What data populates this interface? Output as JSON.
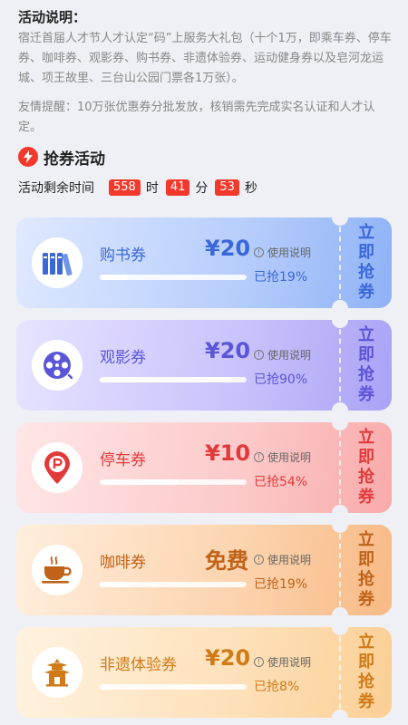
{
  "intro": {
    "title": "活动说明：",
    "body": "宿迁首届人才节人才认定“码”上服务大礼包（十个1万，即乘车券、停车券、咖啡券、观影券、购书券、非遗体验券、运动健身券以及皂河龙运城、项王故里、三台山公园门票各1万张）。",
    "tip": "友情提醒：10万张优惠券分批发放，核销需先完成实名认证和人才认定。"
  },
  "section": {
    "title": "抢券活动"
  },
  "countdown": {
    "label": "活动剩余时间",
    "hours": "558",
    "hours_unit": "时",
    "minutes": "41",
    "minutes_unit": "分",
    "seconds": "53",
    "seconds_unit": "秒"
  },
  "coupons": [
    {
      "name": "购书券",
      "price": "¥20",
      "info": "使用说明",
      "progress": 0.19,
      "progress_label": "已抢19%",
      "grab_label": "立即抢券",
      "icon": "books-icon",
      "accent": "#3a68d8"
    },
    {
      "name": "观影券",
      "price": "¥20",
      "info": "使用说明",
      "progress": 0.9,
      "progress_label": "已抢90%",
      "grab_label": "立即抢券",
      "icon": "film-reel-icon",
      "accent": "#5b55d8"
    },
    {
      "name": "停车券",
      "price": "¥10",
      "info": "使用说明",
      "progress": 0.54,
      "progress_label": "已抢54%",
      "grab_label": "立即抢券",
      "icon": "parking-pin-icon",
      "accent": "#e23a3a"
    },
    {
      "name": "咖啡券",
      "price": "免费",
      "info": "使用说明",
      "progress": 0.19,
      "progress_label": "已抢19%",
      "grab_label": "立即抢券",
      "icon": "coffee-cup-icon",
      "accent": "#c06218"
    },
    {
      "name": "非遗体验券",
      "price": "¥20",
      "info": "使用说明",
      "progress": 0.08,
      "progress_label": "已抢8%",
      "grab_label": "立即抢券",
      "icon": "pagoda-icon",
      "accent": "#d07a18"
    }
  ]
}
